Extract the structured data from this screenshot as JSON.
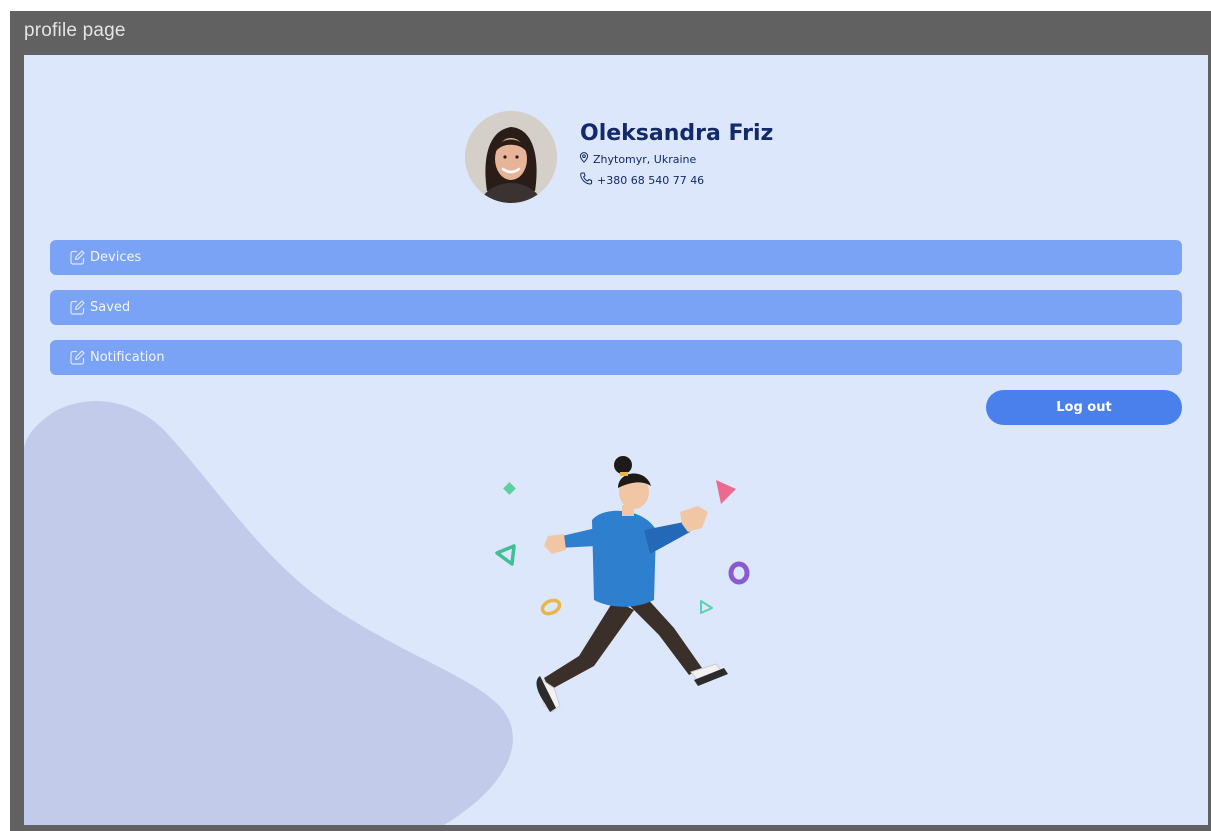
{
  "window": {
    "title": "profile page"
  },
  "profile": {
    "name": "Oleksandra Friz",
    "location": "Zhytomyr, Ukraine",
    "phone": "+380 68 540 77 46",
    "location_icon": "map-pin-icon",
    "phone_icon": "phone-icon"
  },
  "menu": {
    "items": [
      {
        "label": "Devices",
        "icon": "edit-icon"
      },
      {
        "label": "Saved",
        "icon": "edit-icon"
      },
      {
        "label": "Notification",
        "icon": "edit-icon"
      }
    ]
  },
  "actions": {
    "logout_label": "Log out"
  },
  "colors": {
    "frame": "#616161",
    "background": "#dde7fb",
    "blob": "#c2ccea",
    "menu_item": "#7aa2f5",
    "logout_button": "#4a80ec",
    "name_text": "#13296a"
  }
}
